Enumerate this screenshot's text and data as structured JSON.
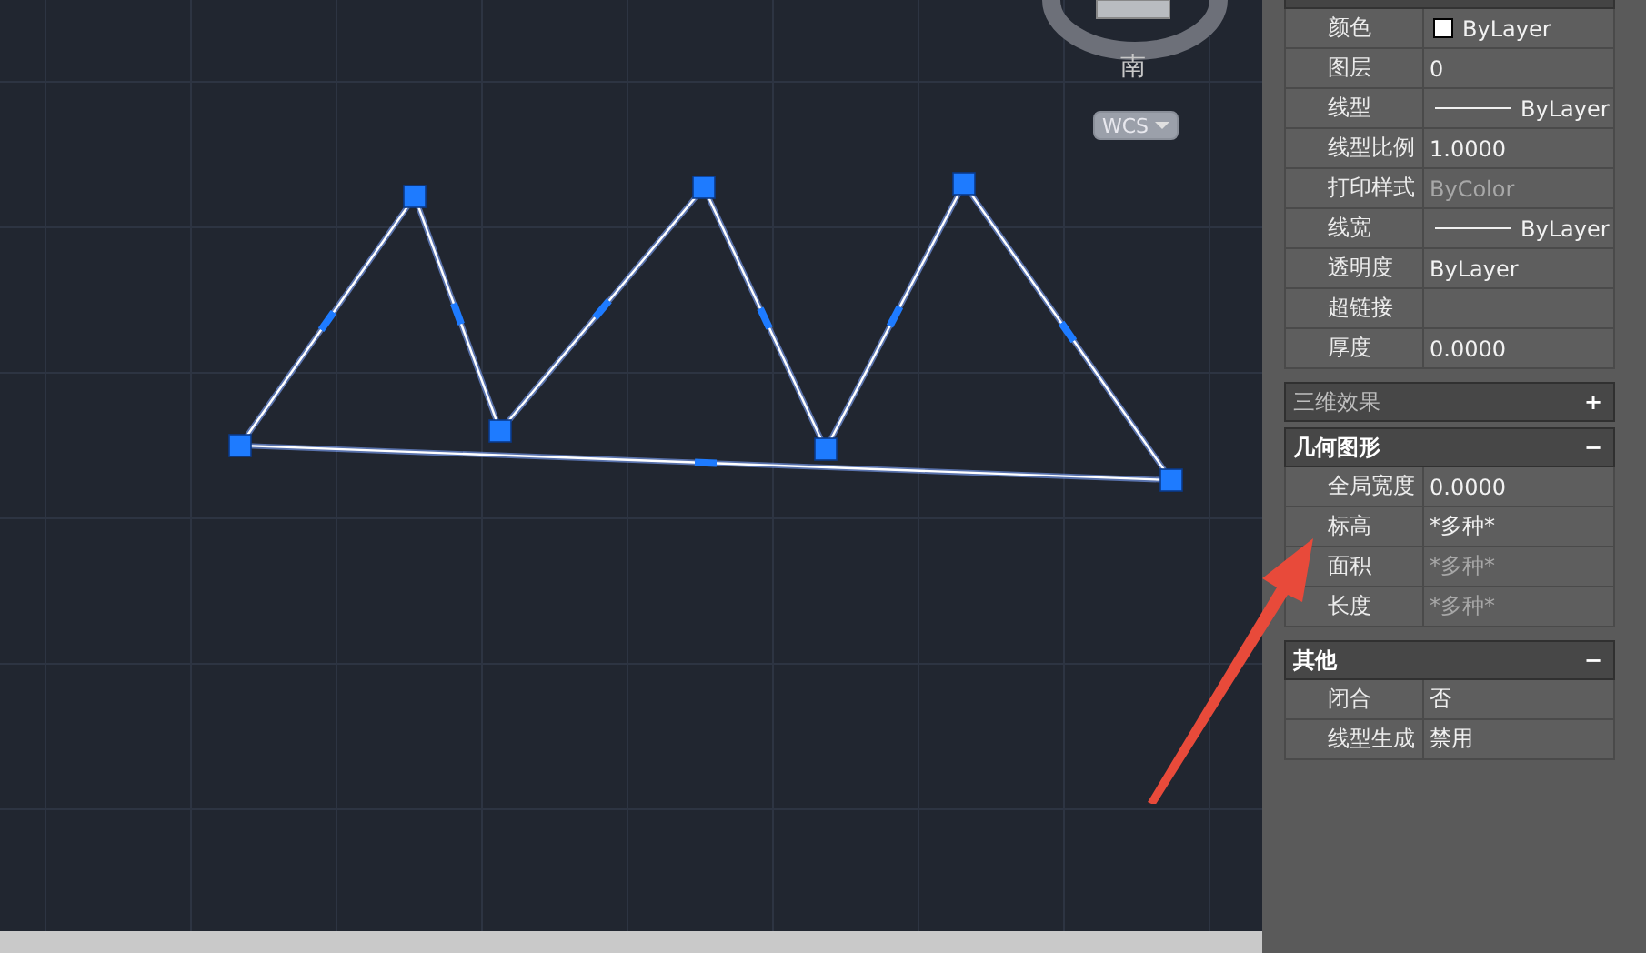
{
  "viewcube": {
    "direction": "南",
    "ucs_button": "WCS"
  },
  "properties": {
    "sections": [
      {
        "rows": [
          {
            "label": "颜色",
            "kind": "swatch",
            "value": "ByLayer",
            "disabled": false
          },
          {
            "label": "图层",
            "kind": "text",
            "value": "0",
            "disabled": false
          },
          {
            "label": "线型",
            "kind": "line",
            "value": "ByLayer",
            "disabled": false
          },
          {
            "label": "线型比例",
            "kind": "text",
            "value": "1.0000",
            "disabled": false
          },
          {
            "label": "打印样式",
            "kind": "text",
            "value": "ByColor",
            "disabled": true
          },
          {
            "label": "线宽",
            "kind": "line",
            "value": "ByLayer",
            "disabled": false
          },
          {
            "label": "透明度",
            "kind": "text",
            "value": "ByLayer",
            "disabled": false
          },
          {
            "label": "超链接"
          },
          {
            "label": "厚度",
            "kind": "text",
            "value": "0.0000",
            "disabled": false
          }
        ]
      },
      {
        "title": "三维效果",
        "toggle": "+",
        "expanded": false
      },
      {
        "title": "几何图形",
        "toggle": "−",
        "expanded": true,
        "rows": [
          {
            "label": "全局宽度",
            "kind": "text",
            "value": "0.0000",
            "disabled": false
          },
          {
            "label": "标高",
            "kind": "text",
            "value": "*多种*",
            "disabled": false
          },
          {
            "label": "面积",
            "kind": "text",
            "value": "*多种*",
            "disabled": true
          },
          {
            "label": "长度",
            "kind": "text",
            "value": "*多种*",
            "disabled": true
          }
        ]
      },
      {
        "title": "其他",
        "toggle": "−",
        "expanded": true,
        "rows": [
          {
            "label": "闭合",
            "kind": "text",
            "value": "否",
            "disabled": false
          },
          {
            "label": "线型生成",
            "kind": "text",
            "value": "禁用",
            "disabled": false
          }
        ]
      }
    ]
  }
}
